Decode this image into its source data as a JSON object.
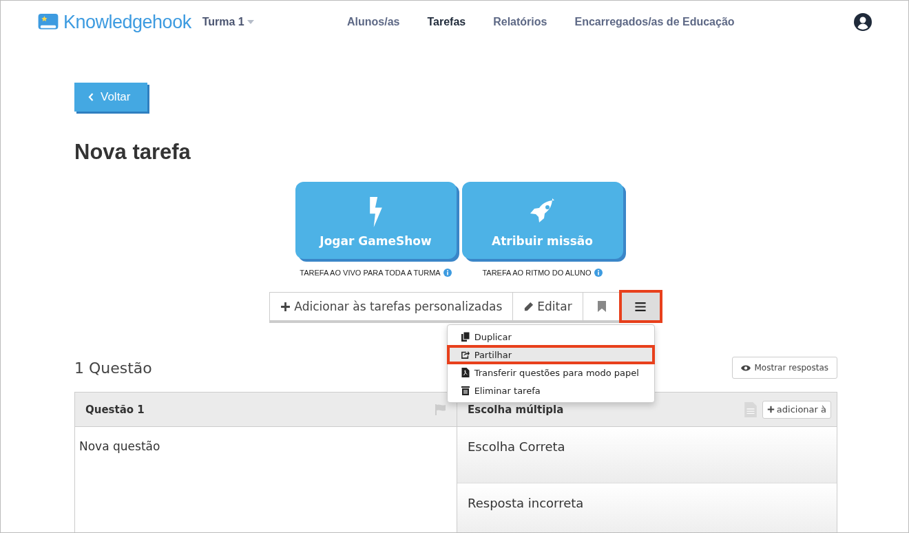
{
  "header": {
    "logo": "Knowledgehook",
    "class_picker": "Turma 1",
    "nav": [
      {
        "label": "Alunos/as",
        "selected": false
      },
      {
        "label": "Tarefas",
        "selected": true
      },
      {
        "label": "Relatórios",
        "selected": false
      },
      {
        "label": "Encarregados/as de Educação",
        "selected": false
      }
    ]
  },
  "back_button": "Voltar",
  "title": "Nova tarefa",
  "modes": [
    {
      "kind": "gameshow",
      "label": "Jogar GameShow",
      "caption": "TAREFA AO VIVO PARA TODA A TURMA"
    },
    {
      "kind": "mission",
      "label": "Atribuir missão",
      "caption": "TAREFA AO RITMO DO ALUNO"
    }
  ],
  "toolbar": {
    "add_button": "Adicionar às tarefas personalizadas",
    "edit_button": "Editar",
    "menu_highlighted": true,
    "menu_expanded": true
  },
  "menu": [
    {
      "kind": "duplicate",
      "label": "Duplicar",
      "highlighted": false
    },
    {
      "kind": "share",
      "label": "Partilhar",
      "highlighted": true
    },
    {
      "kind": "pdf",
      "label": "Transferir questões para modo papel",
      "highlighted": false
    },
    {
      "kind": "delete",
      "label": "Eliminar tarefa",
      "highlighted": false
    }
  ],
  "question_count": "1 Questão",
  "show_answers_button": "Mostrar respostas",
  "question": {
    "heading": "Questão 1",
    "type": "Escolha múltipla",
    "add_button": "adicionar à",
    "text": "Nova questão",
    "choices": [
      "Escolha Correta",
      "Resposta incorreta"
    ]
  }
}
